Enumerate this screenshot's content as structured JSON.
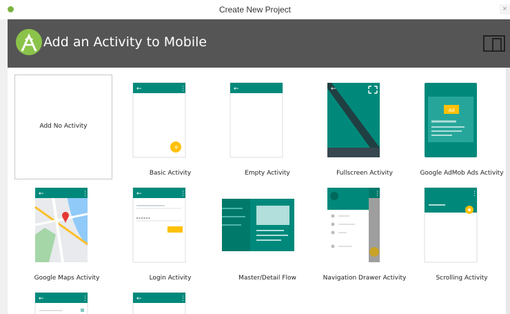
{
  "window": {
    "title": "Create New Project",
    "close_glyph": "×"
  },
  "header": {
    "title": "Add an Activity to Mobile",
    "logo_icon": "android-studio-icon",
    "device_icon": "device-form-factor-icon"
  },
  "colors": {
    "accent": "#00897b",
    "accent_dark": "#00796b",
    "header_bg": "#555555",
    "fab": "#ffc107"
  },
  "tiles": [
    {
      "label": "Add No Activity"
    },
    {
      "label": "Basic Activity"
    },
    {
      "label": "Empty Activity"
    },
    {
      "label": "Fullscreen Activity"
    },
    {
      "label": "Google AdMob Ads Activity",
      "ad_badge": "Ad"
    },
    {
      "label": "Google Maps Activity"
    },
    {
      "label": "Login Activity"
    },
    {
      "label": "Master/Detail Flow"
    },
    {
      "label": "Navigation Drawer Activity"
    },
    {
      "label": "Scrolling Activity"
    },
    {
      "label": ""
    },
    {
      "label": ""
    }
  ]
}
